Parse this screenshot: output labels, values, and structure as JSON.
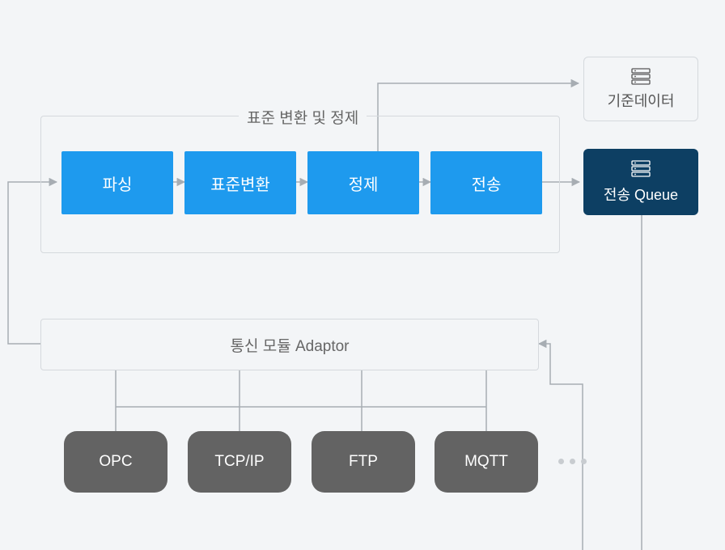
{
  "groups": {
    "std_transform": "표준 변환 및 정제",
    "adaptor": "통신 모듈 Adaptor"
  },
  "pipeline": {
    "parse": "파싱",
    "std": "표준변환",
    "clean": "정제",
    "send": "전송"
  },
  "nodes": {
    "ref_data": "기준데이터",
    "tx_queue": "전송 Queue"
  },
  "protocols": {
    "opc": "OPC",
    "tcpip": "TCP/IP",
    "ftp": "FTP",
    "mqtt": "MQTT"
  },
  "colors": {
    "bg": "#f3f5f7",
    "blue": "#1e9aee",
    "dark": "#0d3f63",
    "gray": "#636363",
    "line": "#a7adb3"
  }
}
